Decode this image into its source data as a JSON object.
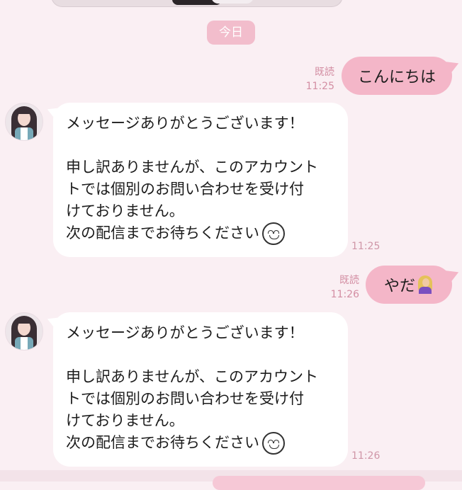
{
  "chat": {
    "date_separator": "今日",
    "messages": [
      {
        "side": "sent",
        "text": "こんにちは",
        "read_label": "既読",
        "time": "11:25"
      },
      {
        "side": "received",
        "lines": {
          "line1": "メッセージありがとうございます！",
          "line2": "申し訳ありませんが、このアカウント\nトでは個別のお問い合わせを受け付\nけておりません。",
          "line3": "次の配信までお待ちください"
        },
        "emoji": "smiley-icon",
        "time": "11:25"
      },
      {
        "side": "sent",
        "text": "やだ",
        "emoji": "person-gesturing-no-icon",
        "read_label": "既読",
        "time": "11:26"
      },
      {
        "side": "received",
        "lines": {
          "line1": "メッセージありがとうございます！",
          "line2": "申し訳ありませんが、このアカウント\nトでは個別のお問い合わせを受け付\nけておりません。",
          "line3": "次の配信までお待ちください"
        },
        "emoji": "smiley-icon",
        "time": "11:26"
      }
    ]
  },
  "colors": {
    "background": "#faeff3",
    "sent_bubble": "#f4b6c8",
    "received_bubble": "#ffffff",
    "meta_text": "#d38ea3",
    "date_pill": "#f2bdcc"
  }
}
